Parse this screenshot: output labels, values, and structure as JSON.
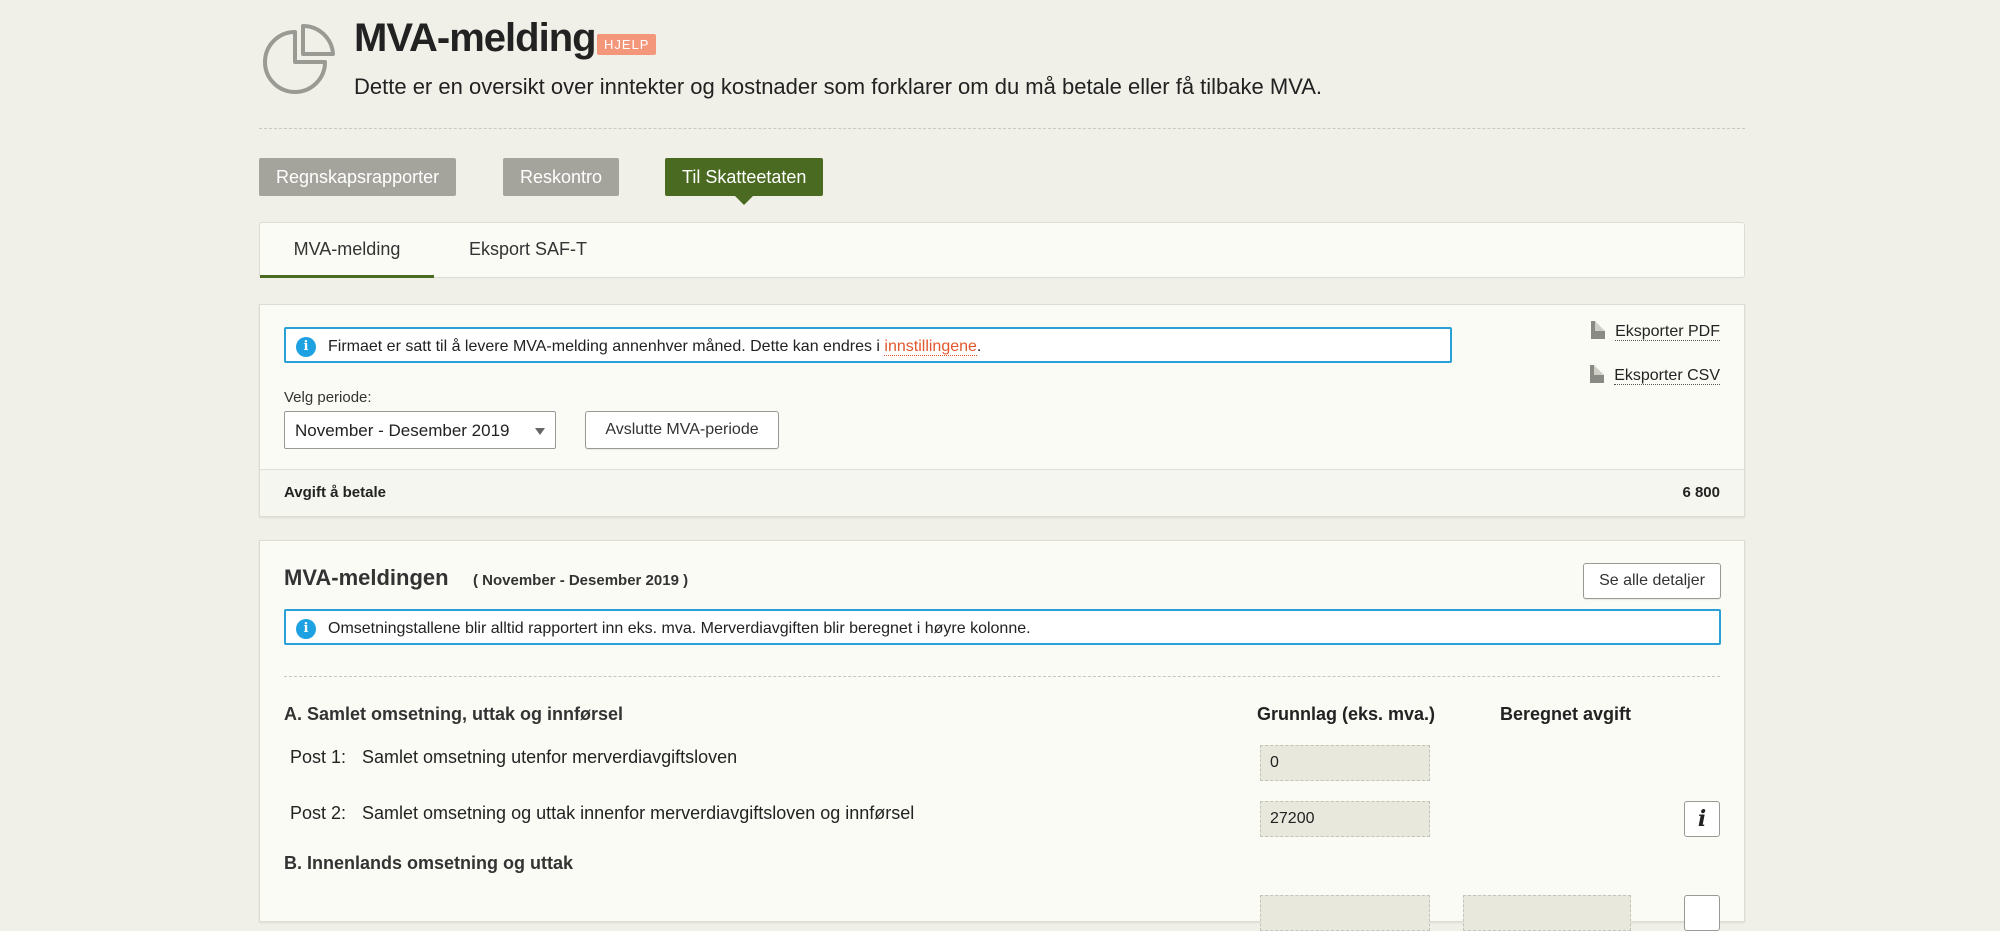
{
  "header": {
    "title": "MVA-melding",
    "help_badge": "HJELP",
    "subtitle": "Dette er en oversikt over inntekter og kostnader som forklarer om du må betale eller få tilbake MVA."
  },
  "nav": {
    "buttons": [
      "Regnskapsrapporter",
      "Reskontro",
      "Til Skatteetaten"
    ],
    "active": "Til Skatteetaten"
  },
  "tabs": [
    "MVA-melding",
    "Eksport SAF-T"
  ],
  "period_panel": {
    "info_text": "Firmaet er satt til å levere MVA-melding annenhver måned. Dette kan endres i ",
    "info_link": "innstillingene",
    "info_end": ".",
    "export_pdf": "Eksporter PDF",
    "export_csv": "Eksporter CSV",
    "period_label": "Velg periode:",
    "period_value": "November - Desember 2019",
    "close_button": "Avslutte MVA-periode",
    "sum_label": "Avgift å betale",
    "sum_value": "6 800"
  },
  "report": {
    "title": "MVA-meldingen",
    "period": "( November - Desember 2019 )",
    "details_button": "Se alle detaljer",
    "info_text": "Omsetningstallene blir alltid rapportert inn eks. mva. Merverdiavgiften blir beregnet i høyre kolonne.",
    "section_a": "A. Samlet omsetning, uttak og innførsel",
    "col_base": "Grunnlag (eks. mva.)",
    "col_tax": "Beregnet avgift",
    "posts": [
      {
        "num": "Post 1:",
        "label": "Samlet omsetning utenfor merverdiavgiftsloven",
        "value": "0"
      },
      {
        "num": "Post 2:",
        "label": "Samlet omsetning og uttak innenfor merverdiavgiftsloven og innførsel",
        "value": "27200"
      }
    ],
    "section_b": "B. Innenlands omsetning og uttak"
  },
  "colors": {
    "accent": "#4a6a21",
    "info": "#2aa0d8",
    "link": "#e2572b",
    "badge": "#f4967a"
  }
}
